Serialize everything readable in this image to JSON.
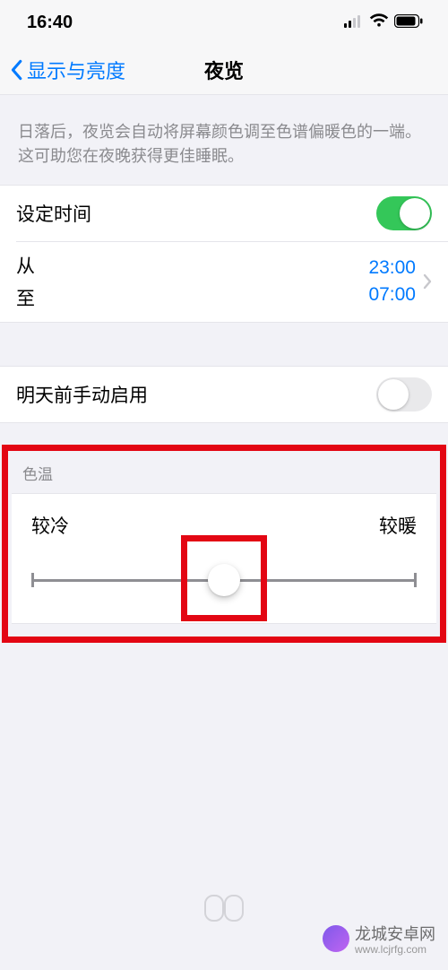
{
  "status": {
    "time": "16:40"
  },
  "nav": {
    "back": "显示与亮度",
    "title": "夜览"
  },
  "description": "日落后，夜览会自动将屏幕颜色调至色谱偏暖色的一端。这可助您在夜晚获得更佳睡眠。",
  "schedule": {
    "toggle_label": "设定时间",
    "toggle_on": true,
    "from_label": "从",
    "to_label": "至",
    "from_time": "23:00",
    "to_time": "07:00"
  },
  "manual": {
    "label": "明天前手动启用",
    "on": false
  },
  "color_temp": {
    "header": "色温",
    "cold": "较冷",
    "warm": "较暖",
    "value_percent": 50
  },
  "watermark": {
    "name": "龙城安卓网",
    "url": "www.lcjrfg.com"
  }
}
